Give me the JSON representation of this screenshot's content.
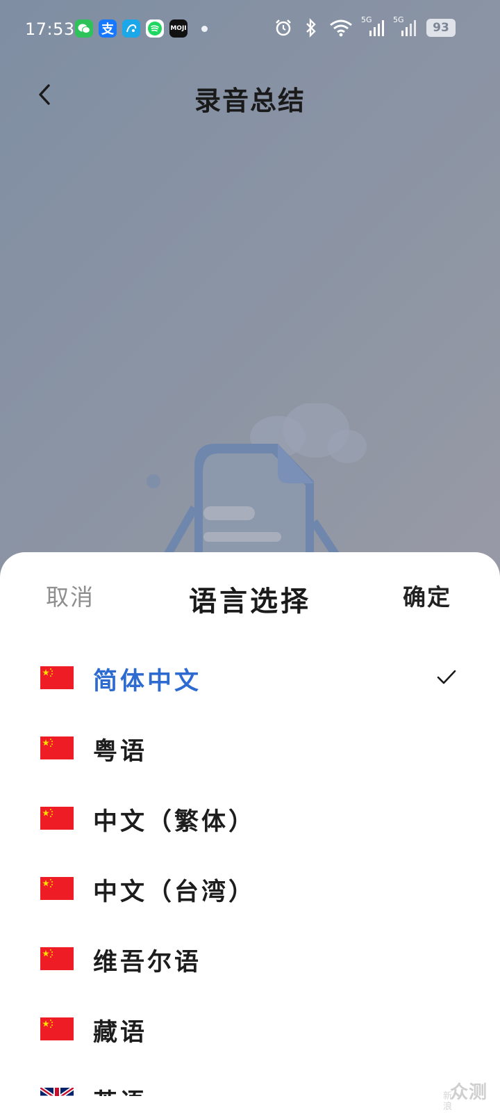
{
  "status_bar": {
    "time": "17:53",
    "battery": "93",
    "signal1_label": "5G",
    "signal2_label": "5G",
    "app_icons": [
      {
        "name": "wechat-icon",
        "color": "#2dc35a",
        "glyph": "✿"
      },
      {
        "name": "alipay-icon",
        "color": "#1677ff",
        "glyph": "支"
      },
      {
        "name": "app-icon-blue",
        "color": "#1ba7e8",
        "glyph": "⟲"
      },
      {
        "name": "spotify-icon",
        "color": "#1ed760",
        "glyph": "≋"
      },
      {
        "name": "moji-icon",
        "color": "#111111",
        "glyph": "MOJI"
      }
    ]
  },
  "header": {
    "title": "录音总结",
    "back_icon": "chevron-left-icon"
  },
  "sheet": {
    "cancel": "取消",
    "title": "语言选择",
    "confirm": "确定",
    "languages": [
      {
        "label": "简体中文",
        "flag": "cn",
        "selected": true
      },
      {
        "label": "粤语",
        "flag": "cn",
        "selected": false
      },
      {
        "label": "中文（繁体）",
        "flag": "cn",
        "selected": false
      },
      {
        "label": "中文（台湾）",
        "flag": "cn",
        "selected": false
      },
      {
        "label": "维吾尔语",
        "flag": "cn",
        "selected": false
      },
      {
        "label": "藏语",
        "flag": "cn",
        "selected": false
      },
      {
        "label": "英语",
        "flag": "uk",
        "selected": false
      }
    ]
  },
  "watermark": {
    "text": "众测",
    "small": "新浪"
  },
  "colors": {
    "accent": "#2e6bd0",
    "sheet_bg": "#ffffff",
    "flag_red": "#ee1c25",
    "flag_star": "#ffde00"
  }
}
